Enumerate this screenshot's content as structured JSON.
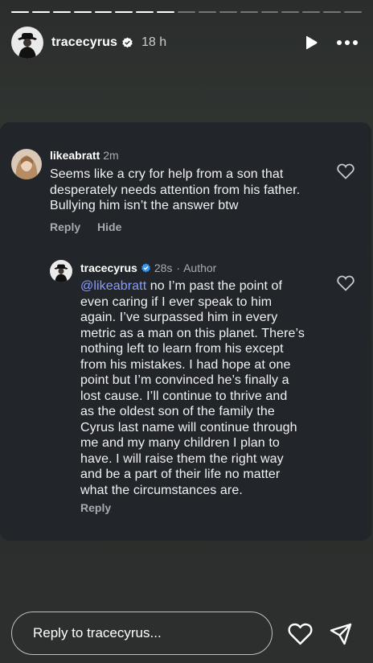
{
  "story": {
    "segments_total": 17,
    "segments_done": 8,
    "username": "tracecyrus",
    "time": "18 h"
  },
  "comment": {
    "username": "likeabratt",
    "time": "2m",
    "text_lines": [
      "Seems like a cry for help from a son that",
      "desperately needs attention from his father.",
      "Bullying him isn’t the answer btw"
    ],
    "reply_label": "Reply",
    "hide_label": "Hide"
  },
  "reply": {
    "username": "tracecyrus",
    "time": "28s",
    "separator": "·",
    "author_label": "Author",
    "mention": "@likeabratt",
    "first_line_rest": " no I’m past the point of",
    "text_lines": [
      "even caring if I ever speak to him",
      "again. I’ve surpassed him in every",
      "metric as a man on this planet. There’s",
      "nothing left to learn from his except",
      "from his mistakes. I had hope at one",
      "point but I’m convinced he’s finally a",
      "lost cause. I’ll continue to thrive and",
      "as the oldest son of the family the",
      "Cyrus last name will continue through",
      "me and my many children I plan to",
      "have. I will raise them the right way",
      "and be a part of their life no matter",
      "what the circumstances are."
    ],
    "reply_label": "Reply"
  },
  "composer": {
    "placeholder": "Reply to tracecyrus..."
  },
  "icons": {
    "play": "play-icon",
    "more": "more-icon",
    "verified": "verified-badge-icon",
    "like": "heart-icon",
    "share": "send-icon"
  },
  "colors": {
    "mention": "#8b9cff",
    "verified": "#3897f0",
    "card": "#22252a"
  }
}
